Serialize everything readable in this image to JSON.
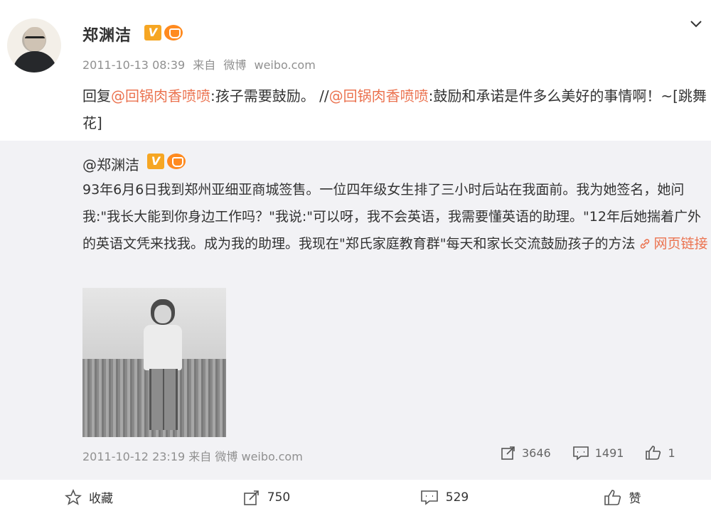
{
  "post": {
    "author": "郑渊洁",
    "timestamp": "2011-10-13 08:39",
    "source_prefix": "来自",
    "source_app": "微博",
    "source_site": "weibo.com",
    "text": {
      "reply_prefix": "回复",
      "mention1": "@回锅肉香喷喷",
      "part1": ":孩子需要鼓励。 //",
      "mention2": "@回锅肉香喷喷",
      "part2": ":鼓励和承诺是件多么美好的事情啊！~[跳舞花]"
    }
  },
  "repost": {
    "author": "@郑渊洁",
    "text": "93年6月6日我到郑州亚细亚商城签售。一位四年级女生排了三小时后站在我面前。我为她签名，她问我:\"我长大能到你身边工作吗？\"我说:\"可以呀，我不会英语，我需要懂英语的助理。\"12年后她揣着广外的英语文凭来找我。成为我的助理。我现在\"郑氏家庭教育群\"每天和家长交流鼓励孩子的方法",
    "link_label": "网页链接",
    "timestamp": "2011-10-12 23:19",
    "source_prefix": "来自",
    "source_app": "微博",
    "source_site": "weibo.com",
    "reposts": "3646",
    "comments": "1491",
    "likes": "1"
  },
  "actions": {
    "favorite": "收藏",
    "repost": "750",
    "comment": "529",
    "like": "赞"
  },
  "icons": {
    "verified": "V",
    "crown": "crown-icon",
    "link": "link-icon",
    "repost": "share-icon",
    "comment": "comment-icon",
    "like": "thumbs-up-icon",
    "favorite": "star-icon",
    "menu": "chevron-down-icon"
  },
  "colors": {
    "accent_link": "#eb7350",
    "verified_badge": "#f6a623",
    "repost_bg": "#f2f2f5",
    "meta_text": "#909090"
  }
}
